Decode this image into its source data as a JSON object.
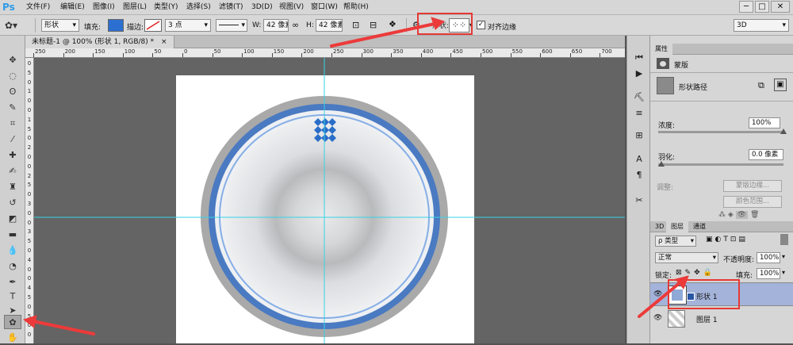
{
  "app": {
    "logo": "Ps"
  },
  "menu": [
    "文件(F)",
    "编辑(E)",
    "图像(I)",
    "图层(L)",
    "类型(Y)",
    "选择(S)",
    "滤镜(T)",
    "3D(D)",
    "视图(V)",
    "窗口(W)",
    "帮助(H)"
  ],
  "window_controls": {
    "minimize": "─",
    "restore": "□",
    "close": "✕"
  },
  "options_bar": {
    "mode": "形状",
    "fill_label": "填充:",
    "stroke_label": "描边:",
    "stroke_width": "3 点",
    "w_label": "W:",
    "w_value": "42 像素",
    "h_label": "H:",
    "h_value": "42 像素",
    "align_edges_label": "对齐边缘",
    "align_edges_checked": true,
    "workspace": "3D",
    "fill_color": "#2c6fd1"
  },
  "document": {
    "tab_title": "未标题-1 @ 100% (形状 1, RGB/8) *",
    "tab_close": "×"
  },
  "rulers": {
    "h_ticks": [
      "250",
      "200",
      "150",
      "100",
      "50",
      "0",
      "50",
      "100",
      "150",
      "200",
      "250",
      "300",
      "350",
      "400",
      "450",
      "500",
      "550",
      "600",
      "650",
      "700"
    ],
    "v_ticks": [
      "0",
      "5",
      "0",
      "1",
      "0",
      "0",
      "1",
      "5",
      "0",
      "2",
      "0",
      "0",
      "2",
      "5",
      "0",
      "3",
      "0",
      "0",
      "3",
      "5",
      "0",
      "4",
      "0",
      "0",
      "4",
      "5",
      "0",
      "5",
      "0",
      "0"
    ]
  },
  "canvas_colors": {
    "outer_ring": "#a9a9a9",
    "blue_ring": "#4a7ac1",
    "thin_ring": "#86aee6",
    "disc": "#edeef0",
    "guide": "#38d3e6",
    "shape_fill": "#2a6ec8"
  },
  "properties_panel": {
    "title": "属性",
    "mask_label": "蒙版",
    "shape_path_label": "形状路径",
    "density_label": "浓度:",
    "density_value": "100%",
    "density_fraction": 1.0,
    "feather_label": "羽化:",
    "feather_value": "0.0 像素",
    "feather_fraction": 0.0,
    "adjust_label": "调整:",
    "mask_edge_button": "蒙版边缘...",
    "color_range_button": "颜色范围..."
  },
  "layers_panel": {
    "tabs": [
      "3D",
      "图层",
      "通道"
    ],
    "filter_kind": "ρ 类型",
    "blend_mode": "正常",
    "opacity_label": "不透明度:",
    "opacity_value": "100%",
    "lock_label": "锁定:",
    "fill_label": "填充:",
    "fill_value": "100%",
    "layers": [
      {
        "name": "形状 1",
        "selected": true
      },
      {
        "name": "图层 1",
        "selected": false
      }
    ]
  }
}
